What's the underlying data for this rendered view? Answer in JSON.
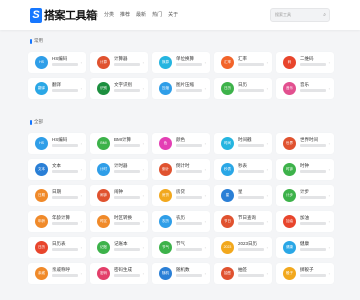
{
  "header": {
    "logo_mark": "S",
    "logo_text": "搭案工具箱",
    "nav": [
      "首页",
      "分类",
      "推荐",
      "最新",
      "热门",
      "关于"
    ],
    "search_placeholder": "搜索工具",
    "search_icon": "search-icon"
  },
  "sections": [
    {
      "title": "常用",
      "cards": [
        {
          "title": "HS编码",
          "icon_text": "HS",
          "color": "#2f9ee8"
        },
        {
          "title": "计算器",
          "icon_text": "计算",
          "color": "#e0522f"
        },
        {
          "title": "单位换算",
          "icon_text": "换算",
          "color": "#25b5e0"
        },
        {
          "title": "汇率",
          "icon_text": "汇率",
          "color": "#f2642a"
        },
        {
          "title": "二维码",
          "icon_text": "码",
          "color": "#e8452c"
        },
        {
          "title": "翻译",
          "icon_text": "翻译",
          "color": "#2aa7e6"
        },
        {
          "title": "文字识别",
          "icon_text": "识别",
          "color": "#1c8f3f"
        },
        {
          "title": "图片压缩",
          "icon_text": "压缩",
          "color": "#2f9ee8"
        },
        {
          "title": "日历",
          "icon_text": "日历",
          "color": "#3db24a"
        },
        {
          "title": "音乐",
          "icon_text": "音乐",
          "color": "#e2508f"
        }
      ]
    },
    {
      "title": "全部",
      "cards": [
        {
          "title": "HS编码",
          "icon_text": "HS",
          "color": "#2f9ee8"
        },
        {
          "title": "BMI计算",
          "icon_text": "BMI",
          "color": "#3db24a"
        },
        {
          "title": "颜色",
          "icon_text": "色",
          "color": "#e33fb4"
        },
        {
          "title": "时间戳",
          "icon_text": "时间",
          "color": "#25b5e0"
        },
        {
          "title": "世界时间",
          "icon_text": "世界",
          "color": "#e0522f"
        },
        {
          "title": "文本",
          "icon_text": "文本",
          "color": "#2a7fd6"
        },
        {
          "title": "计时器",
          "icon_text": "计时",
          "color": "#2f9ee8"
        },
        {
          "title": "倒计时",
          "icon_text": "倒计",
          "color": "#e0522f"
        },
        {
          "title": "秒表",
          "icon_text": "秒表",
          "color": "#2aa7e6"
        },
        {
          "title": "时钟",
          "icon_text": "时钟",
          "color": "#3db24a"
        },
        {
          "title": "日期",
          "icon_text": "日期",
          "color": "#f08a2a"
        },
        {
          "title": "闹钟",
          "icon_text": "闹钟",
          "color": "#e0522f"
        },
        {
          "title": "房贷",
          "icon_text": "房贷",
          "color": "#f2a81d"
        },
        {
          "title": "星",
          "icon_text": "星",
          "color": "#2a7fd6"
        },
        {
          "title": "计步",
          "icon_text": "计步",
          "color": "#3db24a"
        },
        {
          "title": "年龄计算",
          "icon_text": "年龄",
          "color": "#f08a2a"
        },
        {
          "title": "时区转换",
          "icon_text": "时区",
          "color": "#f08a2a"
        },
        {
          "title": "农历",
          "icon_text": "农历",
          "color": "#2f9ee8"
        },
        {
          "title": "节日查询",
          "icon_text": "节日",
          "color": "#e0522f"
        },
        {
          "title": "加油",
          "icon_text": "加油",
          "color": "#e8452c"
        },
        {
          "title": "日历表",
          "icon_text": "日历",
          "color": "#e8452c"
        },
        {
          "title": "记账本",
          "icon_text": "记账",
          "color": "#3db24a"
        },
        {
          "title": "节气",
          "icon_text": "节气",
          "color": "#3db24a"
        },
        {
          "title": "2023日历",
          "icon_text": "2023",
          "color": "#f2a81d"
        },
        {
          "title": "健康",
          "icon_text": "健康",
          "color": "#2aa7e6"
        },
        {
          "title": "亲戚称呼",
          "icon_text": "亲戚",
          "color": "#f08a2a"
        },
        {
          "title": "密码生成",
          "icon_text": "密码",
          "color": "#e33f6a"
        },
        {
          "title": "随机数",
          "icon_text": "随机",
          "color": "#2a7fd6"
        },
        {
          "title": "抽签",
          "icon_text": "抽签",
          "color": "#e0522f"
        },
        {
          "title": "掷骰子",
          "icon_text": "骰子",
          "color": "#f2a81d"
        }
      ]
    }
  ]
}
